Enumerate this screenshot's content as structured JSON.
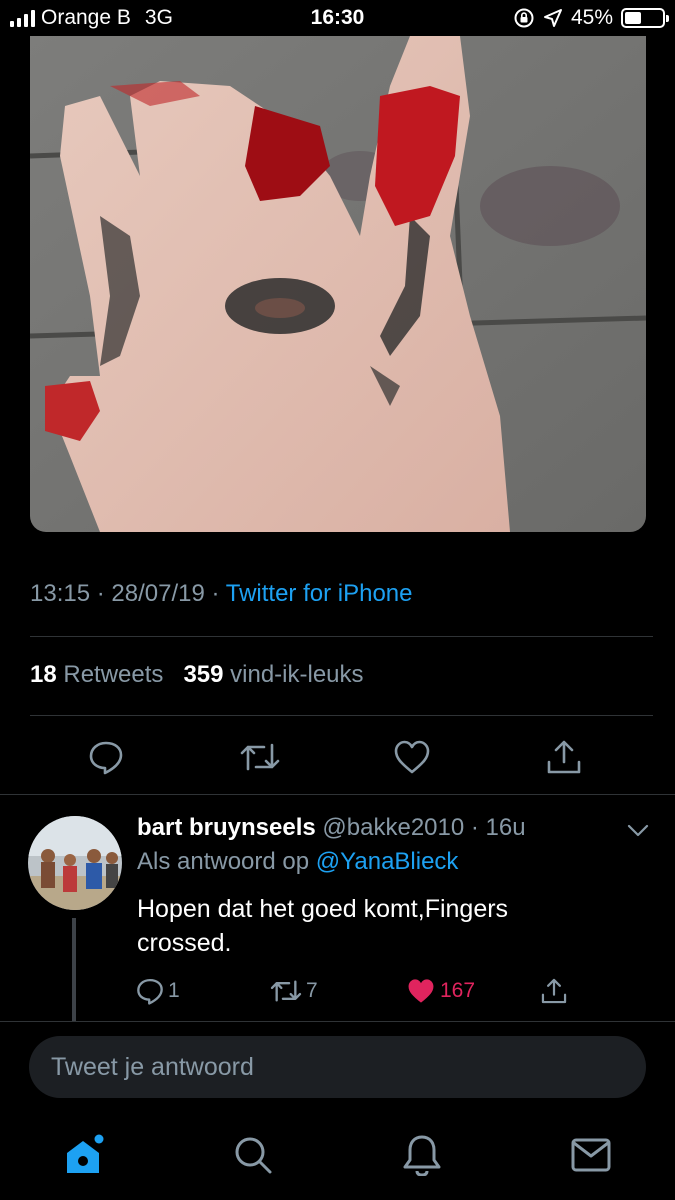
{
  "status_bar": {
    "carrier": "Orange B",
    "network": "3G",
    "time": "16:30",
    "battery": "45%",
    "battery_level": 0.45
  },
  "tweet": {
    "time": "13:15",
    "date": "28/07/19",
    "source": "Twitter for iPhone",
    "retweets_count": "18",
    "retweets_label": "Retweets",
    "likes_count": "359",
    "likes_label": "vind-ik-leuks"
  },
  "reply": {
    "name": "bart bruynseels",
    "handle": "@bakke2010",
    "age": "16u",
    "reply_to_label": "Als antwoord op",
    "reply_to_handle": "@YanaBlieck",
    "text": "Hopen dat het goed komt,Fingers crossed.",
    "replies": "1",
    "retweets": "7",
    "likes": "167"
  },
  "compose": {
    "placeholder": "Tweet je antwoord"
  },
  "colors": {
    "accent": "#1da1f2",
    "like": "#e0245e",
    "muted": "#8899a6"
  },
  "icons": [
    "reply-icon",
    "retweet-icon",
    "like-icon",
    "share-icon",
    "home-icon",
    "search-icon",
    "notifications-icon",
    "messages-icon",
    "chevron-down-icon"
  ]
}
